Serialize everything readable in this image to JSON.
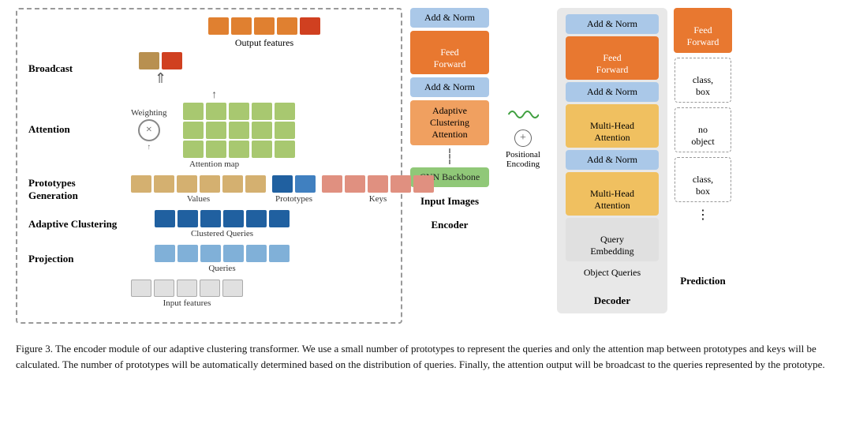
{
  "left_panel": {
    "sections": {
      "output_features_label": "Output features",
      "broadcast_label": "Broadcast",
      "attention_label": "Attention",
      "weighting_label": "Weighting",
      "attention_map_label": "Attention map",
      "prototypes_generation_label": "Prototypes\nGeneration",
      "values_label": "Values",
      "prototypes_label": "Prototypes",
      "keys_label": "Keys",
      "adaptive_clustering_label": "Adaptive Clustering",
      "clustered_queries_label": "Clustered Queries",
      "projection_label": "Projection",
      "queries_label": "Queries",
      "input_features_label": "Input features"
    }
  },
  "encoder": {
    "col_label": "Encoder",
    "add_norm_label": "Add & Norm",
    "feed_forward_label": "Feed\nForward",
    "adaptive_clustering_label": "Adaptive Clustering\nAttention",
    "cnn_backbone_label": "CNN Backbone",
    "input_images_label": "Input Images"
  },
  "decoder": {
    "col_label": "Decoder",
    "add_norm1_label": "Add & Norm",
    "feed_forward_label": "Feed\nForward",
    "add_norm2_label": "Add & Norm",
    "multihead1_label": "Multi-Head\nAttention",
    "add_norm3_label": "Add & Norm",
    "multihead2_label": "Multi-Head\nAttention",
    "query_embedding_label": "Query\nEmbedding",
    "object_queries_label": "Object Queries"
  },
  "prediction": {
    "col_label": "Prediction",
    "feed_forward_label": "Feed\nForward",
    "class_box1_label": "class,\nbox",
    "no_object_label": "no\nobject",
    "class_box2_label": "class,\nbox",
    "dots_label": "⋮"
  },
  "positional_encoding": {
    "label": "Positional\nEncoding"
  },
  "caption": {
    "text": "Figure 3. The encoder module of our adaptive clustering transformer. We use a small number of prototypes to represent the queries and only the attention map between prototypes and keys will be calculated. The number of prototypes will be automatically determined based on the distribution of queries. Finally, the attention output will be broadcast to the queries represented by the prototype."
  },
  "colors": {
    "orange": "#e08030",
    "blue_light": "#aac8e8",
    "orange_feed": "#e87830",
    "green": "#90c878",
    "gray_panel": "#e8e8e8",
    "yellow_multihead": "#f0c060"
  }
}
